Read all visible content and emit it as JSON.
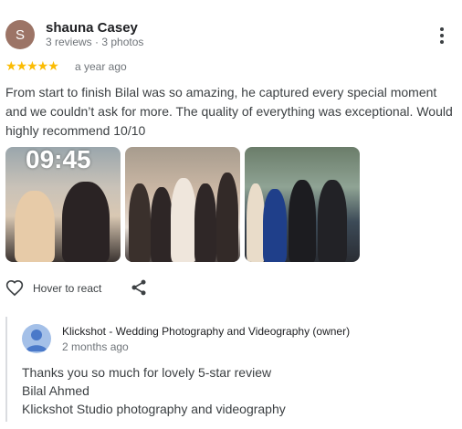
{
  "reviewer": {
    "initial": "S",
    "name": "shauna Casey",
    "meta": "3 reviews · 3 photos",
    "avatar_color": "#9c7466"
  },
  "rating": {
    "stars": "★★★★★",
    "value": 5,
    "max": 5,
    "color": "#fbbc04",
    "time": "a year ago"
  },
  "review_text": "From start to finish Bilal was so amazing, he captured every special moment and we couldn’t ask for more. The quality of everything was exceptional. Would highly recommend 10/10",
  "photos": [
    {
      "overlay_text": "09:45"
    },
    {
      "overlay_text": ""
    },
    {
      "overlay_text": ""
    }
  ],
  "actions": {
    "react_label": "Hover to react",
    "react_icon": "heart-outline-icon",
    "share_icon": "share-icon",
    "menu_icon": "more-vert-icon"
  },
  "owner_response": {
    "name": "Klickshot - Wedding Photography and Videography (owner)",
    "time": "2 months ago",
    "lines": [
      "Thanks you so much for lovely 5-star review",
      "Bilal Ahmed",
      "Klickshot Studio photography and videography"
    ],
    "avatar_icon": "default-user-avatar-icon"
  }
}
